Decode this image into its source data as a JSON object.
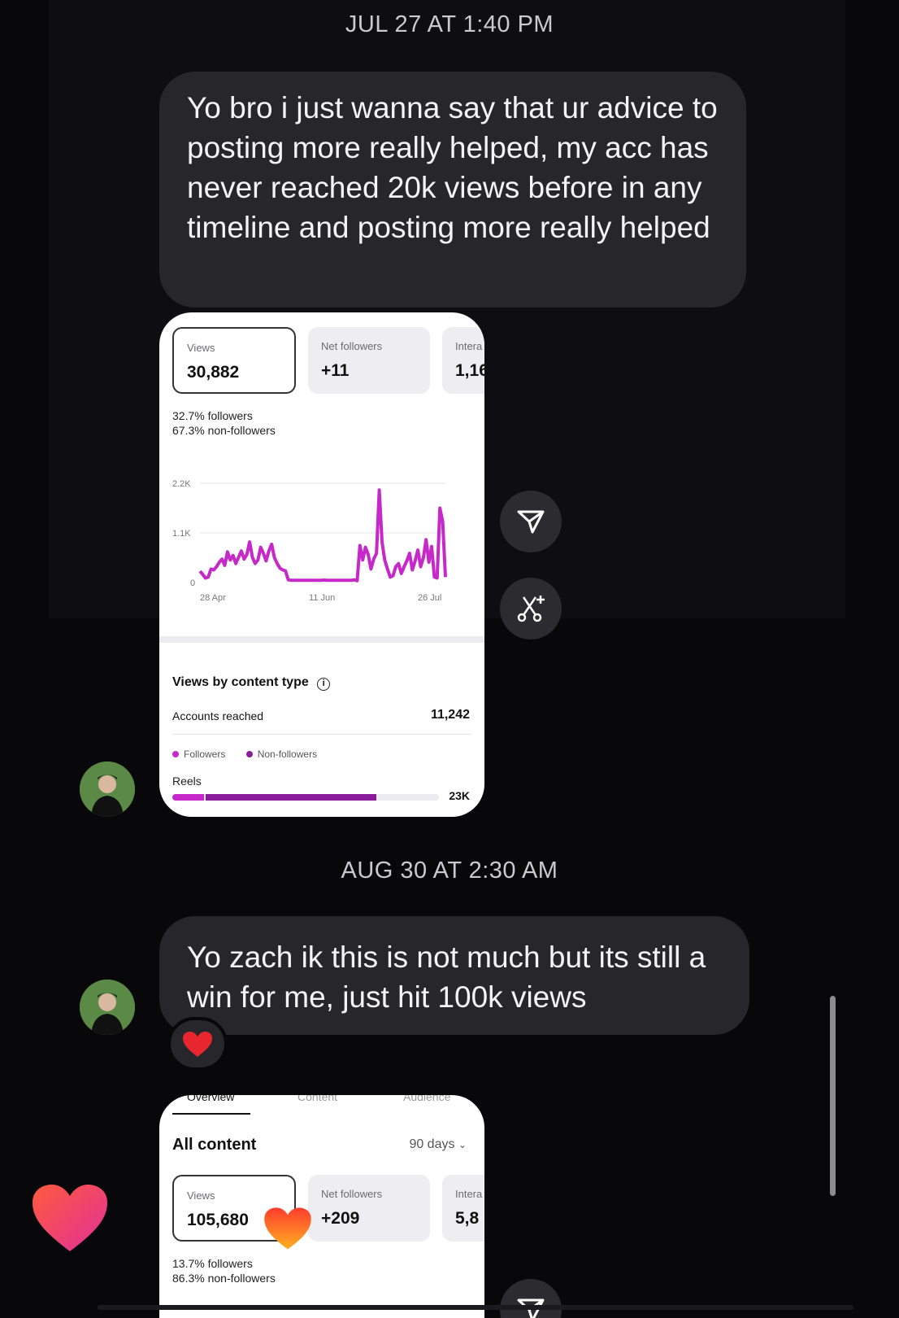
{
  "timestamps": [
    "JUL 27 AT 1:40 PM",
    "AUG 30 AT 2:30 AM"
  ],
  "messages": [
    {
      "text": "Yo bro i just wanna say that ur advice to posting more really helped, my acc has never reached 20k views before in any timeline and posting more really helped"
    },
    {
      "text": "Yo zach ik this is not much but its still a win for me, just hit 100k views"
    }
  ],
  "card1": {
    "metrics": [
      {
        "label": "Views",
        "value": "30,882"
      },
      {
        "label": "Net followers",
        "value": "+11"
      },
      {
        "label": "Intera",
        "value": "1,16"
      }
    ],
    "followers_line": "32.7% followers",
    "nonfollowers_line": "67.3% non-followers",
    "section_title": "Views by content type",
    "accounts_reached_label": "Accounts reached",
    "accounts_reached_value": "11,242",
    "legend": [
      "Followers",
      "Non-followers"
    ],
    "reels_label": "Reels",
    "reels_value": "23K",
    "reels_follower_fraction": 0.12,
    "reels_nonfollower_fraction": 0.64
  },
  "chart_data": {
    "type": "line",
    "x_ticks": [
      "28 Apr",
      "11 Jun",
      "26 Jul"
    ],
    "y_ticks": [
      "0",
      "1.1K",
      "2.2K"
    ],
    "ylim": [
      0,
      2200
    ],
    "color": "#c728c9",
    "values": [
      250,
      180,
      100,
      120,
      300,
      280,
      350,
      450,
      520,
      380,
      680,
      500,
      600,
      420,
      560,
      700,
      520,
      620,
      900,
      560,
      420,
      500,
      780,
      650,
      480,
      700,
      850,
      550,
      420,
      320,
      280,
      260,
      60,
      50,
      50,
      50,
      50,
      50,
      50,
      50,
      50,
      50,
      50,
      50,
      50,
      55,
      50,
      50,
      50,
      50,
      50,
      50,
      50,
      50,
      50,
      50,
      60,
      40,
      820,
      500,
      780,
      620,
      300,
      520,
      650,
      2050,
      900,
      500,
      300,
      120,
      150,
      350,
      420,
      200,
      350,
      480,
      650,
      280,
      480,
      720,
      350,
      550,
      950,
      450,
      800,
      120,
      100,
      1650,
      1350,
      120
    ]
  },
  "card2": {
    "tabs": [
      "Overview",
      "Content",
      "Audience"
    ],
    "title": "All content",
    "range": "90 days",
    "metrics": [
      {
        "label": "Views",
        "value": "105,680"
      },
      {
        "label": "Net followers",
        "value": "+209"
      },
      {
        "label": "Intera",
        "value": "5,8"
      }
    ],
    "followers_line": "13.7% followers",
    "nonfollowers_line": "86.3% non-followers"
  },
  "colors": {
    "accent": "#c728c9",
    "accent_dark": "#8a1b9a",
    "bubble": "#26262b"
  },
  "icons": [
    "send-icon",
    "remix-icon",
    "heart-reaction-icon",
    "heart-icon"
  ]
}
